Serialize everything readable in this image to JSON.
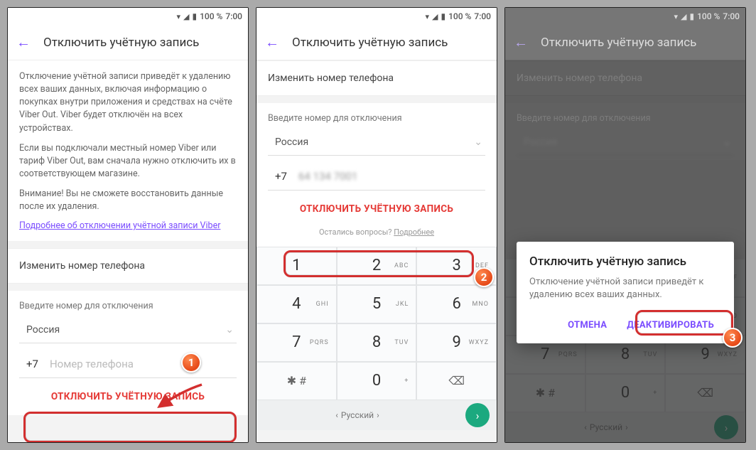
{
  "status": {
    "battery": "100 %",
    "time": "7:00"
  },
  "header": {
    "title": "Отключить учётную запись"
  },
  "info": {
    "p1": "Отключение учётной записи приведёт к удалению всех ваших данных, включая информацию о покупках внутри приложения и средствах на счёте Viber Out. Viber будет отключён на всех устройствах.",
    "p2": "Если вы подключали местный номер Viber или тариф Viber Out, вам сначала нужно отключить их в соответствующем магазине.",
    "p3": "Внимание! Вы не сможете восстановить данные после их удаления.",
    "link": "Подробнее об отключении учётной записи Viber"
  },
  "change_section": "Изменить номер телефона",
  "form": {
    "title": "Введите номер для отключения",
    "country": "Россия",
    "prefix": "+7",
    "placeholder": "Номер телефона"
  },
  "action_button": "ОТКЛЮЧИТЬ УЧЁТНУЮ ЗАПИСЬ",
  "hint": {
    "text": "Остались вопросы? ",
    "link": "Подробнее"
  },
  "keyboard": {
    "rows": [
      [
        {
          "d": "1",
          "l": ""
        },
        {
          "d": "2",
          "l": "ABC"
        },
        {
          "d": "3",
          "l": "DEF"
        }
      ],
      [
        {
          "d": "4",
          "l": "GHI"
        },
        {
          "d": "5",
          "l": "JKL"
        },
        {
          "d": "6",
          "l": "MNO"
        }
      ],
      [
        {
          "d": "7",
          "l": "PQRS"
        },
        {
          "d": "8",
          "l": "TUV"
        },
        {
          "d": "9",
          "l": "WXYZ"
        }
      ],
      [
        {
          "d": "✱ #",
          "l": "",
          "sym": true
        },
        {
          "d": "0",
          "l": "+"
        },
        {
          "d": "⌫",
          "l": "",
          "sym": true
        }
      ]
    ],
    "lang": "Русский"
  },
  "dialog": {
    "title": "Отключить учётную запись",
    "msg": "Отключение учётной записи приведёт к удалению всех ваших данных.",
    "cancel": "ОТМЕНА",
    "confirm": "ДЕАКТИВИРОВАТЬ"
  },
  "badges": {
    "b1": "1",
    "b2": "2",
    "b3": "3"
  }
}
